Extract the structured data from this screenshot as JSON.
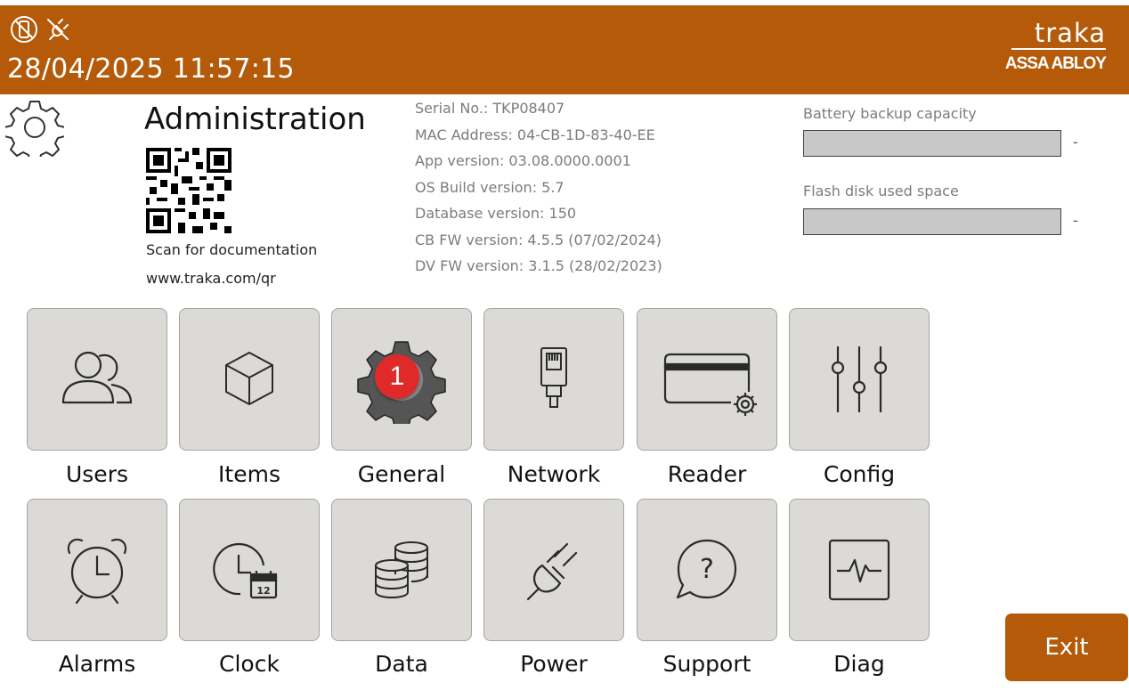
{
  "header": {
    "datetime": "28/04/2025 11:57:15",
    "brand_name": "traka",
    "brand_sub": "ASSA ABLOY",
    "color": "#b45a08",
    "status_icons": [
      "no-mobile-icon",
      "unplugged-icon"
    ]
  },
  "admin": {
    "title": "Administration",
    "qr_caption": "Scan for documentation",
    "qr_url": "www.traka.com/qr"
  },
  "info": [
    "Serial No.:  TKP08407",
    "MAC Address: 04-CB-1D-83-40-EE",
    "App version:  03.08.0000.0001",
    "OS Build version:  5.7",
    "Database version: 150",
    "CB FW version: 4.5.5 (07/02/2024)",
    "DV FW version: 3.1.5 (28/02/2023)"
  ],
  "meters": {
    "battery": {
      "label": "Battery backup capacity",
      "value": "-"
    },
    "flash": {
      "label": "Flash disk used space",
      "value": "-"
    }
  },
  "tiles": [
    {
      "label": "Users",
      "icon": "users-icon"
    },
    {
      "label": "Items",
      "icon": "cube-icon"
    },
    {
      "label": "General",
      "icon": "gear-icon",
      "badge": "1"
    },
    {
      "label": "Network",
      "icon": "ethernet-icon"
    },
    {
      "label": "Reader",
      "icon": "card-reader-icon"
    },
    {
      "label": "Config",
      "icon": "sliders-icon"
    },
    {
      "label": "Alarms",
      "icon": "alarm-clock-icon"
    },
    {
      "label": "Clock",
      "icon": "clock-calendar-icon"
    },
    {
      "label": "Data",
      "icon": "database-icon"
    },
    {
      "label": "Power",
      "icon": "plug-icon"
    },
    {
      "label": "Support",
      "icon": "help-bubble-icon"
    },
    {
      "label": "Diag",
      "icon": "pulse-monitor-icon"
    }
  ],
  "exit_label": "Exit"
}
